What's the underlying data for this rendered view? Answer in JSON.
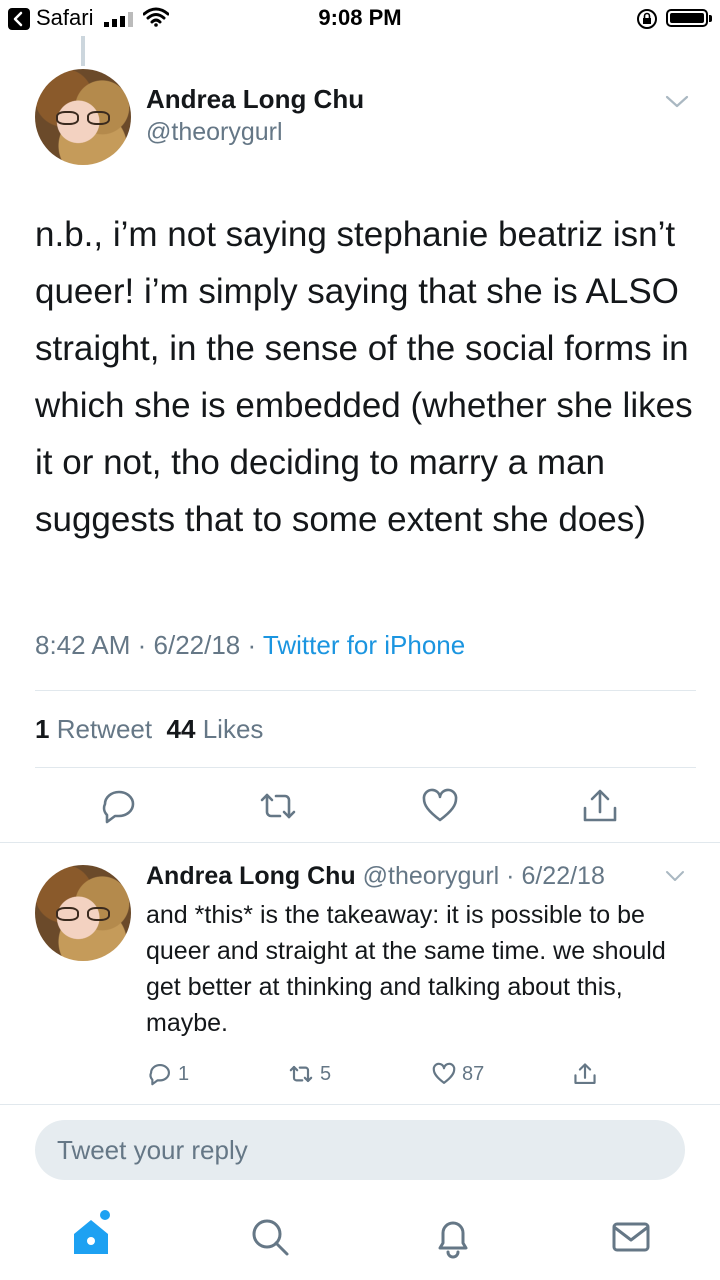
{
  "status_bar": {
    "back_app": "Safari",
    "time": "9:08 PM"
  },
  "tweet": {
    "author_name": "Andrea Long Chu",
    "author_handle": "@theorygurl",
    "text": "n.b., i’m not saying stephanie beatriz isn’t queer! i’m simply saying that she is ALSO straight, in the sense of the social forms in which she is embedded (whether she likes it or not, tho deciding to marry a man suggests that to some extent she does)",
    "time": "8:42 AM",
    "date": "6/22/18",
    "source": "Twitter for iPhone",
    "retweet_count": "1",
    "retweet_label": "Retweet",
    "like_count": "44",
    "like_label": "Likes"
  },
  "reply": {
    "author_name": "Andrea Long Chu",
    "author_handle": "@theorygurl",
    "date": "6/22/18",
    "text": "and *this* is the takeaway: it is possible to be queer and straight at the same time. we should get better at thinking and talking about this, maybe.",
    "reply_count": "1",
    "retweet_count": "5",
    "like_count": "87"
  },
  "composer": {
    "placeholder": "Tweet your reply"
  },
  "colors": {
    "accent": "#1da1f2",
    "link": "#1b95e0",
    "muted": "#657786",
    "divider": "#e1e8ed"
  },
  "icons": {
    "tabs": [
      "home-icon",
      "search-icon",
      "notifications-icon",
      "messages-icon"
    ],
    "actions": [
      "reply-icon",
      "retweet-icon",
      "like-icon",
      "share-icon"
    ]
  }
}
